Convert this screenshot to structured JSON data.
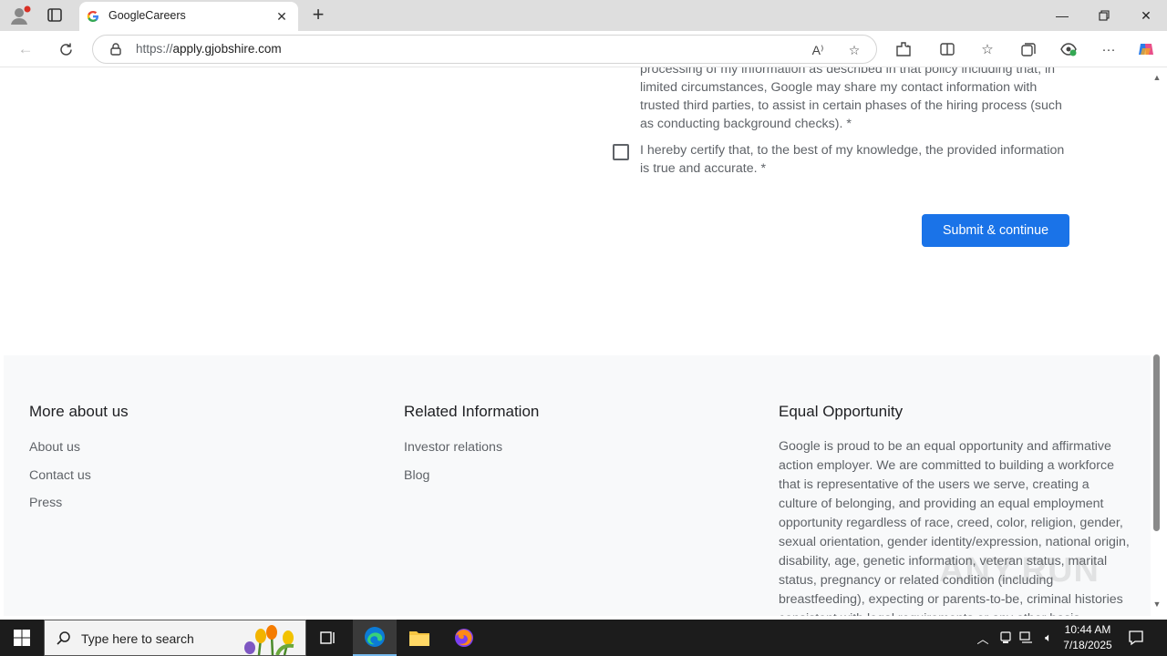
{
  "browser": {
    "tab_title": "GoogleCareers",
    "url_scheme": "https://",
    "url_host": "apply.gjobshire.com"
  },
  "form": {
    "consent_text": "processing of my information as described in that policy including that, in limited circumstances, Google may share my contact information with trusted third parties, to assist in certain phases of the hiring process (such as conducting background checks). *",
    "certify_text": "I hereby certify that, to the best of my knowledge, the provided information is true and accurate. *",
    "submit_label": "Submit & continue"
  },
  "footer": {
    "col1": {
      "title": "More about us",
      "links": [
        "About us",
        "Contact us",
        "Press"
      ]
    },
    "col2": {
      "title": "Related Information",
      "links": [
        "Investor relations",
        "Blog"
      ]
    },
    "col3": {
      "title": "Equal Opportunity",
      "text": "Google is proud to be an equal opportunity and affirmative action employer. We are committed to building a workforce that is representative of the users we serve, creating a culture of belonging, and providing an equal employment opportunity regardless of race, creed, color, religion, gender, sexual orientation, gender identity/expression, national origin, disability, age, genetic information, veteran status, marital status, pregnancy or related condition (including breastfeeding), expecting or parents-to-be, criminal histories consistent with legal requirements or any other basis protected by law."
    }
  },
  "watermark": "ANY.RUN",
  "taskbar": {
    "search_placeholder": "Type here to search",
    "time": "10:44 AM",
    "date": "7/18/2025"
  },
  "colors": {
    "accent": "#1a73e8",
    "footer_bg": "#f8f9fa",
    "taskbar_bg": "#1c1c1c"
  }
}
